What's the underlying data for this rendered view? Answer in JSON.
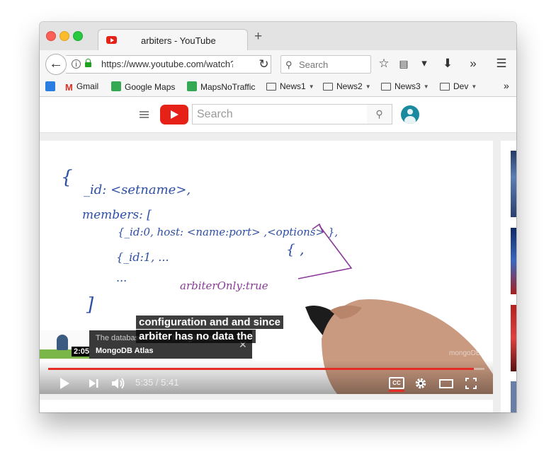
{
  "browser": {
    "tab_title": "arbiters - YouTube",
    "new_tab_symbol": "+",
    "url": "https://www.youtube.com/watch?",
    "search_placeholder": "Search",
    "bookmarks": [
      "Gmail",
      "Google Maps",
      "MapsNoTraffic",
      "News1",
      "News2",
      "News3",
      "Dev"
    ]
  },
  "youtube": {
    "search_placeholder": "Search"
  },
  "video": {
    "whiteboard_lines": [
      "{",
      "_id: <setname>,",
      "members: [",
      "{_id:0, host: <name:port> ,<options> },",
      "{_id:1, ...",
      "...",
      "]",
      "{ ,",
      "arbiterOnly:true"
    ],
    "captions": [
      "configuration and and since",
      "arbiter has no data the"
    ],
    "ad": {
      "duration": "2:05",
      "title": "The database service for agile teams.",
      "channel": "MongoDB Atlas"
    },
    "watermark": "mongoDB",
    "current_time": "5:35",
    "total_time": "5:41",
    "time_display": "5:35 / 5:41",
    "progress_fraction": 0.976,
    "cc_label": "CC"
  },
  "colors": {
    "accent": "#e52d27",
    "marker_blue": "#2d4fa5",
    "marker_purple": "#8b3a9a"
  }
}
